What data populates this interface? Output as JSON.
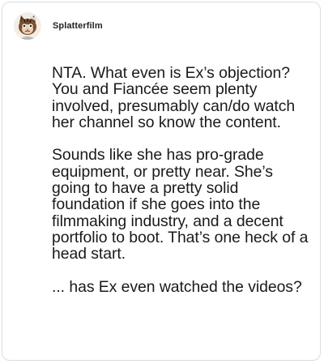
{
  "post": {
    "author": {
      "username": "Splatterfilm",
      "avatar_icon": "cat-avatar-icon"
    },
    "paragraphs": [
      "NTA. What even is Ex’s objection? You and Fiancée seem plenty involved, presumably can/do watch her channel so know the content.",
      "Sounds like she has pro-grade equipment, or pretty near. She’s going to have a pretty solid foundation if she goes into the filmmaking industry, and a decent portfolio to boot. That’s one heck of a head start.",
      "... has Ex even watched the videos?"
    ]
  },
  "colors": {
    "card_border": "#dcdcdc",
    "text": "#1a1a1a",
    "username": "#222222"
  }
}
